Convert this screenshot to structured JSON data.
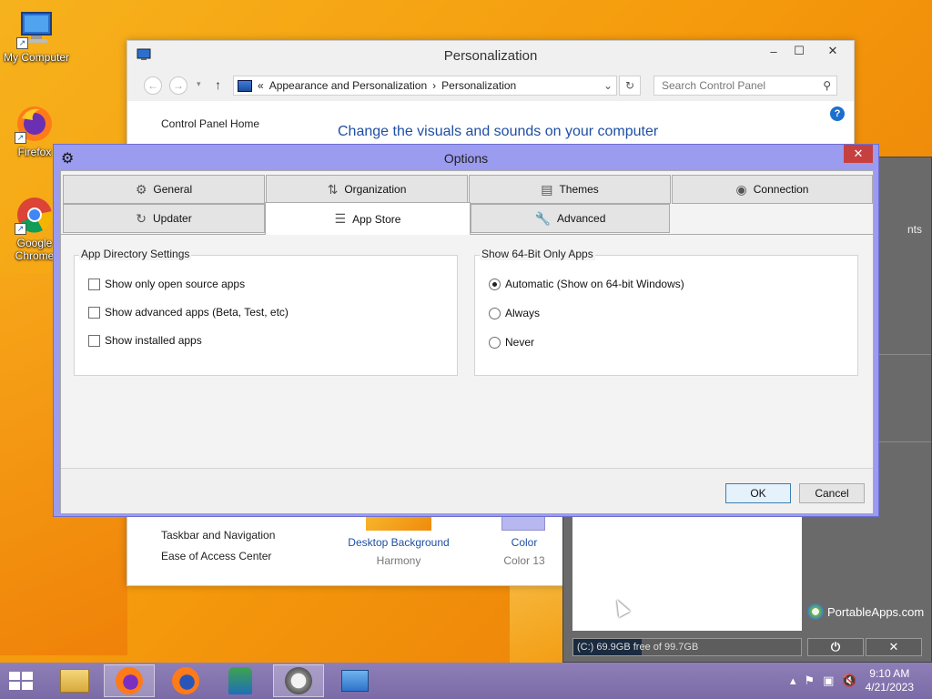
{
  "desktop": {
    "icons": [
      {
        "label": "My Computer",
        "icon": "my-computer-icon"
      },
      {
        "label": "Firefox",
        "icon": "firefox-icon"
      },
      {
        "label": "Google Chrome",
        "icon": "chrome-icon"
      }
    ]
  },
  "cp_window": {
    "title": "Personalization",
    "address_prefix": "«",
    "breadcrumb": [
      "Appearance and Personalization",
      "Personalization"
    ],
    "breadcrumb_sep": "›",
    "search_placeholder": "Search Control Panel",
    "home_link": "Control Panel Home",
    "headline": "Change the visuals and sounds on your computer",
    "side_links": [
      "Taskbar and Navigation",
      "Ease of Access Center"
    ],
    "desktop_background_link": "Desktop Background",
    "desktop_background_sub": "Harmony",
    "color_link": "Color",
    "color_sub": "Color 13"
  },
  "portableapps": {
    "partial_text": "nts",
    "logo_text": "PortableApps.com",
    "disk_text": "(C:) 69.9GB free of 99.7GB",
    "disk_used_fraction": 0.3
  },
  "options_dialog": {
    "title": "Options",
    "tabs_row1": [
      {
        "label": "General",
        "icon": "gear-icon"
      },
      {
        "label": "Organization",
        "icon": "sort-icon"
      },
      {
        "label": "Themes",
        "icon": "theme-icon"
      },
      {
        "label": "Connection",
        "icon": "connection-icon"
      }
    ],
    "tabs_row2": [
      {
        "label": "Updater",
        "icon": "updater-icon"
      },
      {
        "label": "App Store",
        "icon": "grid-list-icon",
        "active": true
      },
      {
        "label": "Advanced",
        "icon": "wrench-icon"
      }
    ],
    "app_directory": {
      "legend": "App Directory Settings",
      "options": [
        {
          "label": "Show only open source apps",
          "checked": false
        },
        {
          "label": "Show advanced apps (Beta, Test, etc)",
          "checked": false
        },
        {
          "label": "Show installed apps",
          "checked": false
        }
      ]
    },
    "bit64": {
      "legend": "Show 64-Bit Only Apps",
      "options": [
        {
          "label": "Automatic (Show on 64-bit Windows)",
          "selected": true
        },
        {
          "label": "Always",
          "selected": false
        },
        {
          "label": "Never",
          "selected": false
        }
      ]
    },
    "ok_label": "OK",
    "cancel_label": "Cancel"
  },
  "taskbar": {
    "time": "9:10 AM",
    "date": "4/21/2023"
  }
}
